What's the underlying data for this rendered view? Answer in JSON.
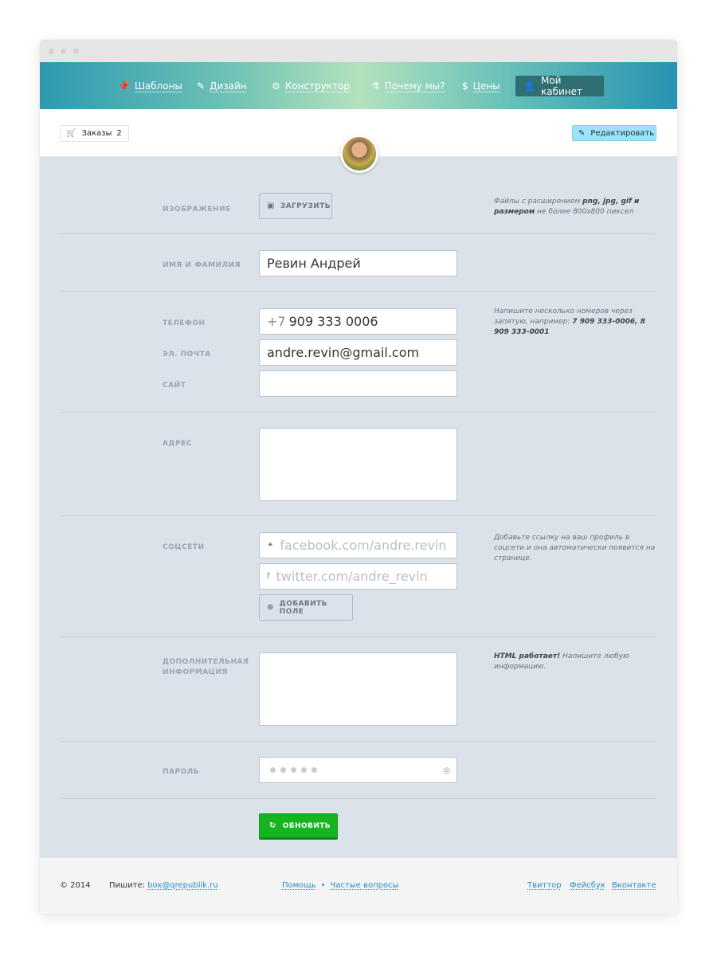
{
  "nav": {
    "items": [
      {
        "icon": "pin-icon",
        "glyph": "📌",
        "label": "Шаблоны"
      },
      {
        "icon": "magic-wand-icon",
        "glyph": "✎",
        "label": "Дизайн"
      },
      {
        "icon": "gears-icon",
        "glyph": "⚙",
        "label": "Конструктор"
      },
      {
        "icon": "flask-icon",
        "glyph": "⚗",
        "label": "Почему мы?"
      },
      {
        "icon": "dollar-icon",
        "glyph": "$",
        "label": "Цены"
      }
    ],
    "cabinet": {
      "icon": "user-icon",
      "glyph": "👤",
      "label": "Мой кабинет"
    }
  },
  "profile": {
    "orders_label": "Заказы",
    "orders_count": "2",
    "edit_label": "Редактировать"
  },
  "form": {
    "image": {
      "label": "ИЗОБРАЖЕНИЕ",
      "button": "ЗАГРУЗИТЬ",
      "hint_pre": "Файлы с расширением ",
      "hint_bold1": "png, jpg, gif и размером",
      "hint_post": " не более 800x800 пиксел"
    },
    "name": {
      "label": "ИМЯ И ФАМИЛИЯ",
      "value": "Ревин Андрей"
    },
    "phone": {
      "label": "ТЕЛЕФОН",
      "prefix": "+7",
      "value": "909 333 0006",
      "hint_pre": "Напишите несколько номеров через запятую, например: ",
      "hint_bold": "7 909 333-0006, 8 909 333-0001"
    },
    "email": {
      "label": "ЭЛ. ПОЧТА",
      "value": "andre.revin@gmail.com"
    },
    "site": {
      "label": "САЙТ",
      "value": ""
    },
    "address": {
      "label": "АДРЕС"
    },
    "social": {
      "label": "СОЦСЕТИ",
      "field1_placeholder": "facebook.com/andre.revin",
      "field2_placeholder": "twitter.com/andre_revin",
      "add_button": "ДОБАВИТЬ ПОЛЕ",
      "hint": "Добавьте ссылку на ваш профиль в соцсети и она автоматически появится  на странице."
    },
    "extra": {
      "label": "ДОПОЛНИТЕЛЬНАЯ ИНФОРМАЦИЯ",
      "hint_bold": "HTML работает!",
      "hint_post": " Напишите любую информацию."
    },
    "password": {
      "label": "ПАРОЛЬ",
      "dots": 5
    },
    "submit": "ОБНОВИТЬ"
  },
  "footer": {
    "copyright": "© 2014",
    "write_label": "Пишите:",
    "email": "box@qrepublik.ru",
    "help": "Помощь",
    "faq": "Частые вопросы",
    "twitter": "Твиттор",
    "facebook": "Фейсбук",
    "vk": "Вконтакте"
  },
  "colors": {
    "accent": "#2d99b0",
    "submit": "#16b51f",
    "edit_button": "#9fe1f7",
    "form_background": "#dbe2e9",
    "link": "#1f8ec4"
  }
}
